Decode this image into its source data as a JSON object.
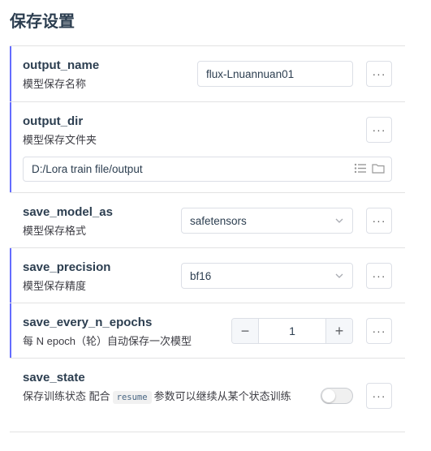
{
  "page": {
    "title": "保存设置"
  },
  "colors": {
    "accent": "#646cff",
    "border": "#e2e2e3"
  },
  "more_label": "···",
  "rows": {
    "output_name": {
      "key": "output_name",
      "desc": "模型保存名称",
      "value": "flux-Lnuannuan01"
    },
    "output_dir": {
      "key": "output_dir",
      "desc": "模型保存文件夹",
      "value": "D:/Lora train file/output"
    },
    "save_model_as": {
      "key": "save_model_as",
      "desc": "模型保存格式",
      "value": "safetensors"
    },
    "save_precision": {
      "key": "save_precision",
      "desc": "模型保存精度",
      "value": "bf16"
    },
    "save_every_n_epochs": {
      "key": "save_every_n_epochs",
      "desc": "每 N epoch（轮）自动保存一次模型",
      "value": "1",
      "minus": "−",
      "plus": "+"
    },
    "save_state": {
      "key": "save_state",
      "desc_before": "保存训练状态 配合",
      "code": "resume",
      "desc_after": "参数可以继续从某个状态训练",
      "enabled": false
    }
  }
}
